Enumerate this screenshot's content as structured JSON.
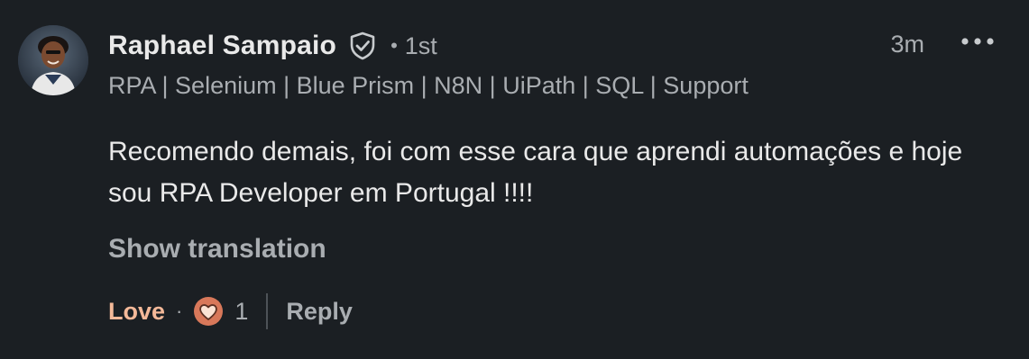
{
  "author": {
    "name": "Raphael Sampaio",
    "degree": "1st",
    "headline": "RPA | Selenium | Blue Prism | N8N | UiPath | SQL | Support",
    "verified_icon": "shield-check-icon",
    "avatar_icon": "profile-photo"
  },
  "meta": {
    "separator": "•",
    "timestamp": "3m",
    "more_icon": "ellipsis-icon"
  },
  "comment": {
    "text": "Recomendo demais, foi com esse cara que aprendi automações e hoje sou RPA Developer em Portugal !!!!"
  },
  "translation": {
    "label": "Show translation"
  },
  "actions": {
    "reaction_label": "Love",
    "separator": "·",
    "reaction_icon": "heart-icon",
    "reaction_count": "1",
    "reply_label": "Reply"
  },
  "colors": {
    "background": "#1b1f23",
    "primary_text": "#e9e9e9",
    "secondary_text": "#a9adb1",
    "love_accent": "#f4b999",
    "heart_badge": "#d8785a"
  }
}
